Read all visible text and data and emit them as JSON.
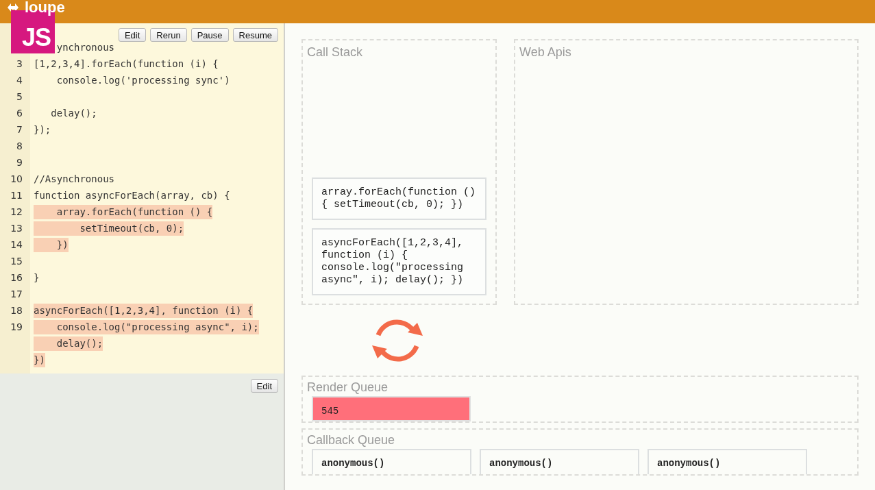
{
  "app": {
    "title": "loupe",
    "badge": "JS"
  },
  "editor": {
    "buttons": [
      "Edit",
      "Rerun",
      "Pause",
      "Resume"
    ],
    "lines": [
      {
        "code": "    ynchronous",
        "highlighted": false
      },
      {
        "number": "3",
        "code": "[1,2,3,4].forEach(function (i) {",
        "highlighted": false
      },
      {
        "number": "4",
        "code": "    console.log('processing sync')",
        "highlighted": false
      },
      {
        "number": "5"
      },
      {
        "number": "6",
        "code": "   delay();",
        "highlighted": false
      },
      {
        "number": "7",
        "code": "});",
        "highlighted": false
      },
      {
        "number": "8"
      },
      {
        "number": "9"
      },
      {
        "number": "10",
        "code": "//Asynchronous",
        "highlighted": false
      },
      {
        "number": "11",
        "code": "function asyncForEach(array, cb) {",
        "highlighted": false
      },
      {
        "number": "12",
        "code": "    array.forEach(function () {",
        "highlighted": true
      },
      {
        "number": "13",
        "code": "        setTimeout(cb, 0);",
        "highlighted": true
      },
      {
        "number": "14",
        "code": "    })",
        "highlighted": true
      },
      {
        "number": "15"
      },
      {
        "number": "16",
        "code": "}",
        "highlighted": false
      },
      {
        "number": "17"
      },
      {
        "number": "18",
        "code": "asyncForEach([1,2,3,4], function (i) {",
        "highlighted": true
      },
      {
        "number": "19",
        "code": "    console.log(\"processing async\", i);",
        "highlighted": true
      },
      {
        "code": "    delay();",
        "highlighted": true
      },
      {
        "code": "})",
        "highlighted": true
      }
    ],
    "footer_button": "Edit"
  },
  "call_stack": {
    "title": "Call Stack",
    "frames": [
      "array.forEach(function () { setTimeout(cb, 0); })",
      "asyncForEach([1,2,3,4], function (i) { console.log(\"processing async\", i); delay(); })"
    ]
  },
  "web_apis": {
    "title": "Web Apis"
  },
  "render_queue": {
    "title": "Render Queue",
    "items": [
      "545"
    ]
  },
  "callback_queue": {
    "title": "Callback Queue",
    "items": [
      "anonymous()",
      "anonymous()",
      "anonymous()"
    ]
  }
}
